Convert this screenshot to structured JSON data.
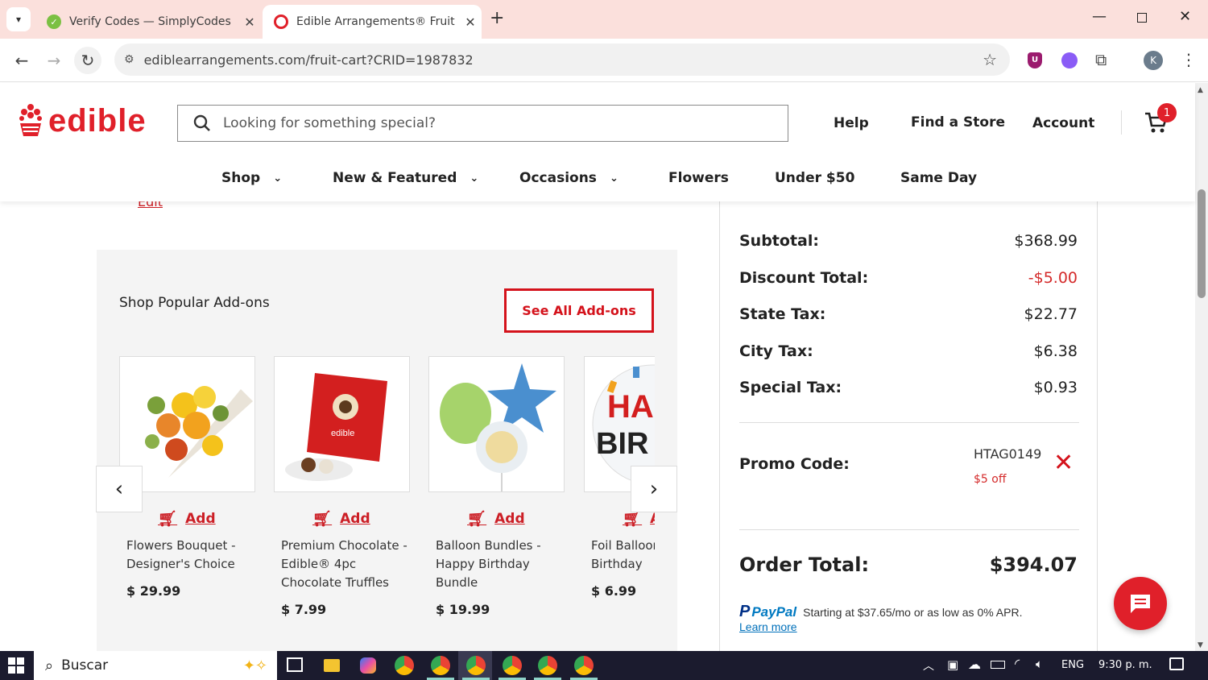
{
  "browser": {
    "tabs": [
      {
        "title": "Verify Codes — SimplyCodes"
      },
      {
        "title": "Edible Arrangements® Fruit Ba"
      }
    ],
    "url": "ediblearrangements.com/fruit-cart?CRID=1987832",
    "profile_initial": "K"
  },
  "site": {
    "brand": "edible",
    "search_placeholder": "Looking for something special?",
    "header_links": {
      "help": "Help",
      "find_store": "Find a Store",
      "account": "Account"
    },
    "cart_count": "1",
    "nav": [
      {
        "label": "Shop"
      },
      {
        "label": "New & Featured"
      },
      {
        "label": "Occasions"
      },
      {
        "label": "Flowers"
      },
      {
        "label": "Under $50"
      },
      {
        "label": "Same Day"
      }
    ],
    "edit_link": "Edit"
  },
  "addons": {
    "heading": "Shop Popular Add-ons",
    "see_all": "See All Add-ons",
    "add_label": "Add",
    "items": [
      {
        "name": "Flowers Bouquet - Designer's Choice",
        "price": "$ 29.99"
      },
      {
        "name": "Premium Chocolate - Edible® 4pc Chocolate Truffles",
        "price": "$ 7.99"
      },
      {
        "name": "Balloon Bundles - Happy Birthday Bundle",
        "price": "$ 19.99"
      },
      {
        "name": "Foil Balloon Birthday",
        "price": "$ 6.99"
      }
    ]
  },
  "summary": {
    "rows": [
      {
        "label": "Subtotal:",
        "value": "$368.99"
      },
      {
        "label": "Discount Total:",
        "value": "-$5.00"
      },
      {
        "label": "State Tax:",
        "value": "$22.77"
      },
      {
        "label": "City Tax:",
        "value": "$6.38"
      },
      {
        "label": "Special Tax:",
        "value": "$0.93"
      }
    ],
    "promo_label": "Promo Code:",
    "promo_code": "HTAG0149",
    "promo_desc": "$5 off",
    "total_label": "Order Total:",
    "total_value": "$394.07",
    "paypal_brand": "PayPal",
    "paypal_text": "Starting at $37.65/mo or as low as 0% APR.",
    "learn_more": "Learn more"
  },
  "taskbar": {
    "search": "Buscar",
    "lang": "ENG",
    "time": "9:30 p. m."
  },
  "colors": {
    "brand_red": "#e0202a",
    "discount_red": "#d42a2a"
  }
}
